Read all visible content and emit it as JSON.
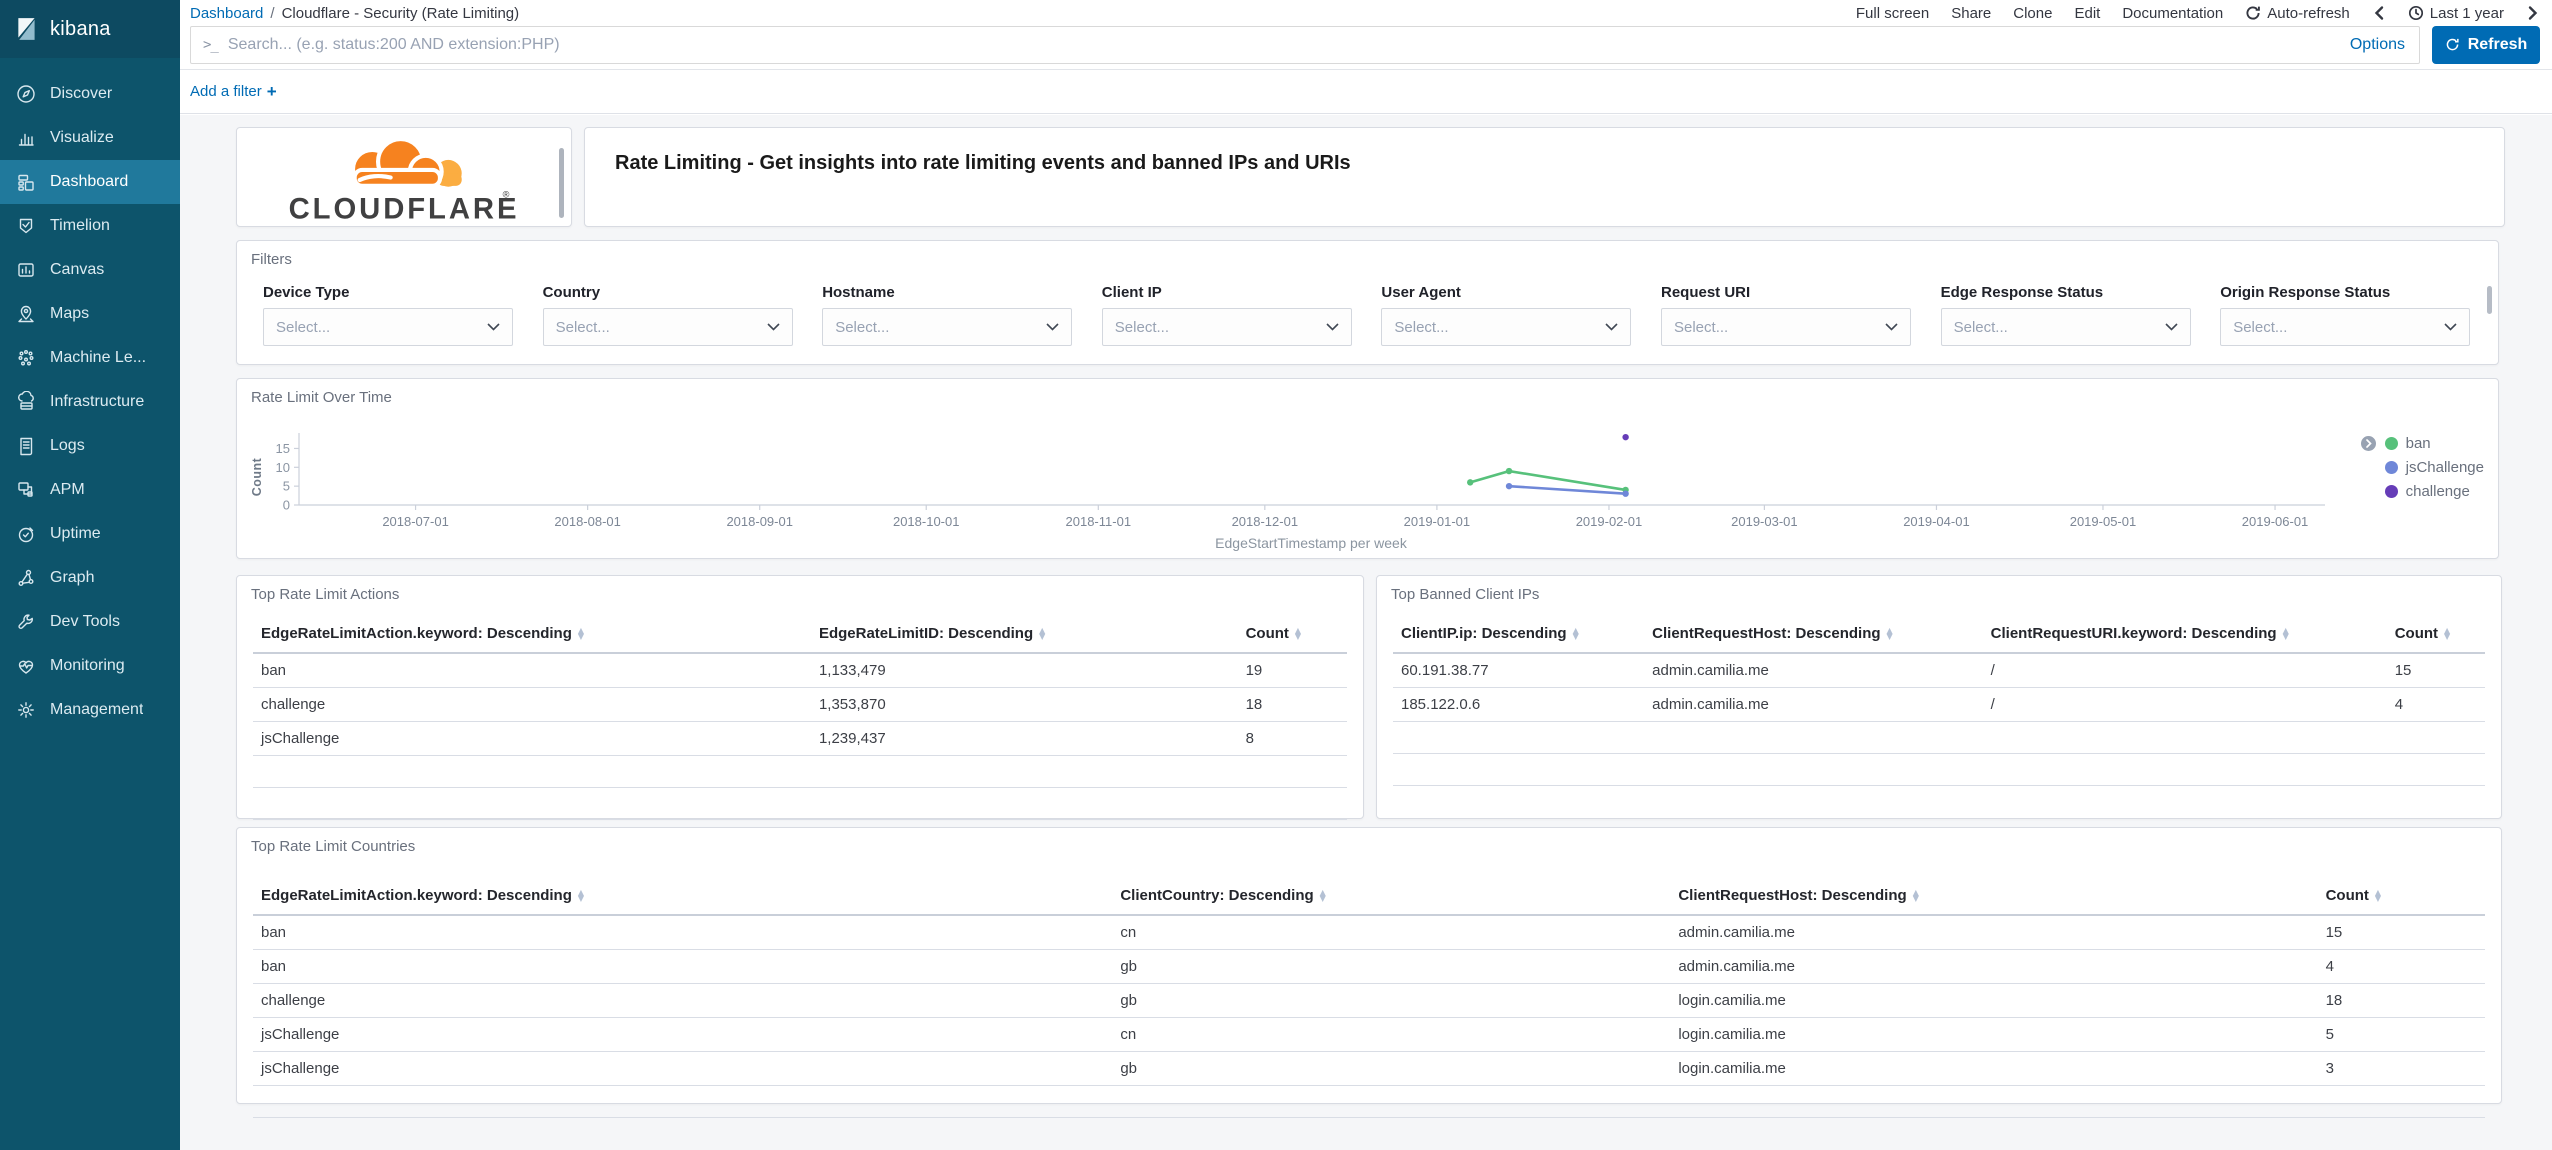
{
  "chrome": {
    "logo_text": "kibana",
    "breadcrumb": {
      "link": "Dashboard",
      "separator": "/",
      "current": "Cloudflare - Security (Rate Limiting)"
    },
    "top_menu": [
      "Full screen",
      "Share",
      "Clone",
      "Edit",
      "Documentation"
    ],
    "auto_refresh_label": "Auto-refresh",
    "time_label": "Last 1 year",
    "search": {
      "prompt_glyph": ">_",
      "placeholder": "Search... (e.g. status:200 AND extension:PHP)",
      "options_label": "Options",
      "refresh_label": "Refresh"
    },
    "add_filter_label": "Add a filter",
    "add_filter_plus": "+"
  },
  "sidebar": {
    "items": [
      {
        "label": "Discover",
        "icon": "discover-icon",
        "active": false
      },
      {
        "label": "Visualize",
        "icon": "visualize-icon",
        "active": false
      },
      {
        "label": "Dashboard",
        "icon": "dashboard-icon",
        "active": true
      },
      {
        "label": "Timelion",
        "icon": "timelion-icon",
        "active": false
      },
      {
        "label": "Canvas",
        "icon": "canvas-icon",
        "active": false
      },
      {
        "label": "Maps",
        "icon": "maps-icon",
        "active": false
      },
      {
        "label": "Machine Le...",
        "icon": "machine-learning-icon",
        "active": false
      },
      {
        "label": "Infrastructure",
        "icon": "infrastructure-icon",
        "active": false
      },
      {
        "label": "Logs",
        "icon": "logs-icon",
        "active": false
      },
      {
        "label": "APM",
        "icon": "apm-icon",
        "active": false
      },
      {
        "label": "Uptime",
        "icon": "uptime-icon",
        "active": false
      },
      {
        "label": "Graph",
        "icon": "graph-icon",
        "active": false
      },
      {
        "label": "Dev Tools",
        "icon": "dev-tools-icon",
        "active": false
      },
      {
        "label": "Monitoring",
        "icon": "monitoring-icon",
        "active": false
      },
      {
        "label": "Management",
        "icon": "management-icon",
        "active": false
      }
    ]
  },
  "panels": {
    "brand": {
      "wordmark": "CLOUDFLARE",
      "registered_mark": "®"
    },
    "description": {
      "text": "Rate Limiting - Get insights into rate limiting events and banned IPs and URIs"
    },
    "filters": {
      "title": "Filters",
      "select_placeholder": "Select...",
      "fields": [
        {
          "label": "Device Type"
        },
        {
          "label": "Country"
        },
        {
          "label": "Hostname"
        },
        {
          "label": "Client IP"
        },
        {
          "label": "User Agent"
        },
        {
          "label": "Request URI"
        },
        {
          "label": "Edge Response Status"
        },
        {
          "label": "Origin Response Status"
        }
      ]
    },
    "actions_table": {
      "title": "Top Rate Limit Actions",
      "columns": [
        "EdgeRateLimitAction.keyword: Descending",
        "EdgeRateLimitID: Descending",
        "Count"
      ],
      "rows": [
        [
          "ban",
          "1,133,479",
          "19"
        ],
        [
          "challenge",
          "1,353,870",
          "18"
        ],
        [
          "jsChallenge",
          "1,239,437",
          "8"
        ]
      ]
    },
    "ips_table": {
      "title": "Top Banned Client IPs",
      "columns": [
        "ClientIP.ip: Descending",
        "ClientRequestHost: Descending",
        "ClientRequestURI.keyword: Descending",
        "Count"
      ],
      "rows": [
        [
          "60.191.38.77",
          "admin.camilia.me",
          "/",
          "15"
        ],
        [
          "185.122.0.6",
          "admin.camilia.me",
          "/",
          "4"
        ]
      ]
    },
    "countries_table": {
      "title": "Top Rate Limit Countries",
      "columns": [
        "EdgeRateLimitAction.keyword: Descending",
        "ClientCountry: Descending",
        "ClientRequestHost: Descending",
        "Count"
      ],
      "rows": [
        [
          "ban",
          "cn",
          "admin.camilia.me",
          "15"
        ],
        [
          "ban",
          "gb",
          "admin.camilia.me",
          "4"
        ],
        [
          "challenge",
          "gb",
          "login.camilia.me",
          "18"
        ],
        [
          "jsChallenge",
          "cn",
          "login.camilia.me",
          "5"
        ],
        [
          "jsChallenge",
          "gb",
          "login.camilia.me",
          "3"
        ]
      ]
    }
  },
  "chart_data": {
    "type": "line",
    "title": "Rate Limit Over Time",
    "xlabel": "EdgeStartTimestamp per week",
    "ylabel": "Count",
    "ylim": [
      0,
      20
    ],
    "yticks": [
      0,
      5,
      10,
      15
    ],
    "xticks": [
      "2018-07-01",
      "2018-08-01",
      "2018-09-01",
      "2018-10-01",
      "2018-11-01",
      "2018-12-01",
      "2019-01-01",
      "2019-02-01",
      "2019-03-01",
      "2019-04-01",
      "2019-05-01",
      "2019-06-01"
    ],
    "x_domain": [
      "2018-06-10",
      "2019-06-10"
    ],
    "grid": false,
    "legend_position": "right",
    "series": [
      {
        "name": "ban",
        "color": "#57c17b",
        "points": [
          [
            "2019-01-07",
            6
          ],
          [
            "2019-01-14",
            9
          ],
          [
            "2019-02-04",
            4
          ]
        ]
      },
      {
        "name": "jsChallenge",
        "color": "#6f87d8",
        "points": [
          [
            "2019-01-14",
            5
          ],
          [
            "2019-02-04",
            3
          ]
        ]
      },
      {
        "name": "challenge",
        "color": "#663db8",
        "points": [
          [
            "2019-02-04",
            18
          ]
        ]
      }
    ]
  },
  "colors": {
    "accent_link": "#006bb4",
    "refresh_button": "#006bb4",
    "sidebar_bg": "#0d546b",
    "sidebar_active": "#20799c",
    "cloudflare_orange": "#f6821f",
    "cloudflare_light_orange": "#fbad41"
  }
}
